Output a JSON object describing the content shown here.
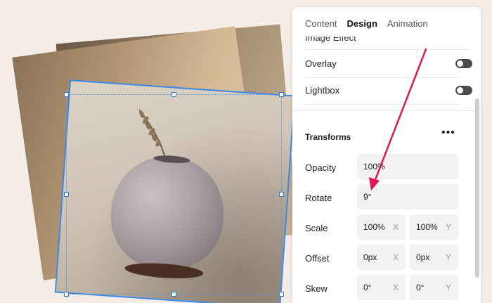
{
  "panel": {
    "tabs": [
      {
        "label": "Content",
        "active": false
      },
      {
        "label": "Design",
        "active": true
      },
      {
        "label": "Animation",
        "active": false
      }
    ],
    "cut_row_label": "Image Effect",
    "rows": [
      {
        "label": "Overlay",
        "toggle": "off"
      },
      {
        "label": "Lightbox",
        "toggle": "off"
      }
    ],
    "transforms": {
      "title": "Transforms",
      "menu_icon": "more-horizontal-icon",
      "opacity": {
        "label": "Opacity",
        "value": "100%"
      },
      "rotate": {
        "label": "Rotate",
        "value": "9°"
      },
      "scale": {
        "label": "Scale",
        "x_value": "100%",
        "x_axis": "X",
        "y_value": "100%",
        "y_axis": "Y"
      },
      "offset": {
        "label": "Offset",
        "x_value": "0px",
        "x_axis": "X",
        "y_value": "0px",
        "y_axis": "Y"
      },
      "skew": {
        "label": "Skew",
        "x_value": "0°",
        "x_axis": "X",
        "y_value": "0°",
        "y_axis": "Y"
      }
    }
  },
  "colors": {
    "selection": "#3b8ae6",
    "annotation_arrow": "#e0174f",
    "toggle_track": "#4b4b4b"
  }
}
